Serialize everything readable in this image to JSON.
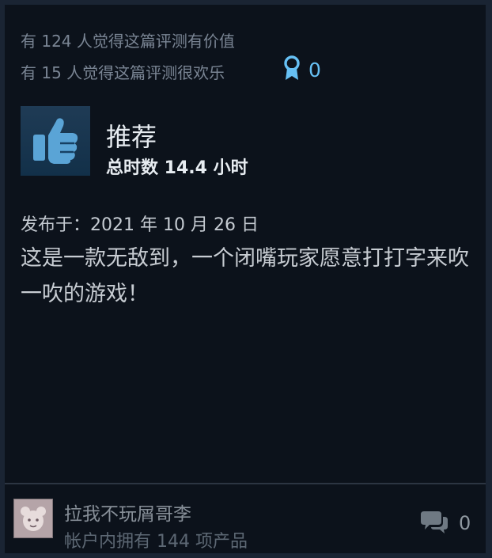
{
  "review": {
    "helpful_text": "有 124 人觉得这篇评测有价值",
    "funny_text": "有 15 人觉得这篇评测很欢乐",
    "award_count": "0",
    "recommendation": "推荐",
    "hours": "总时数 14.4 小时",
    "posted": "发布于：2021 年 10 月 26 日",
    "body": "这是一款无敌到，一个闭嘴玩家愿意打打字来吹一吹的游戏！"
  },
  "author": {
    "name": "拉我不玩屑哥李",
    "products": "帐户内拥有 144 项产品"
  },
  "comments": {
    "count": "0"
  },
  "colors": {
    "accent": "#66c0f4",
    "card_bg": "#0c121b",
    "outer_bg": "#1a2433",
    "thumb_blue": "#5aa4d6"
  },
  "icons": {
    "award": "award-ribbon-icon",
    "thumb": "thumbs-up-icon",
    "comment": "comment-bubbles-icon"
  }
}
